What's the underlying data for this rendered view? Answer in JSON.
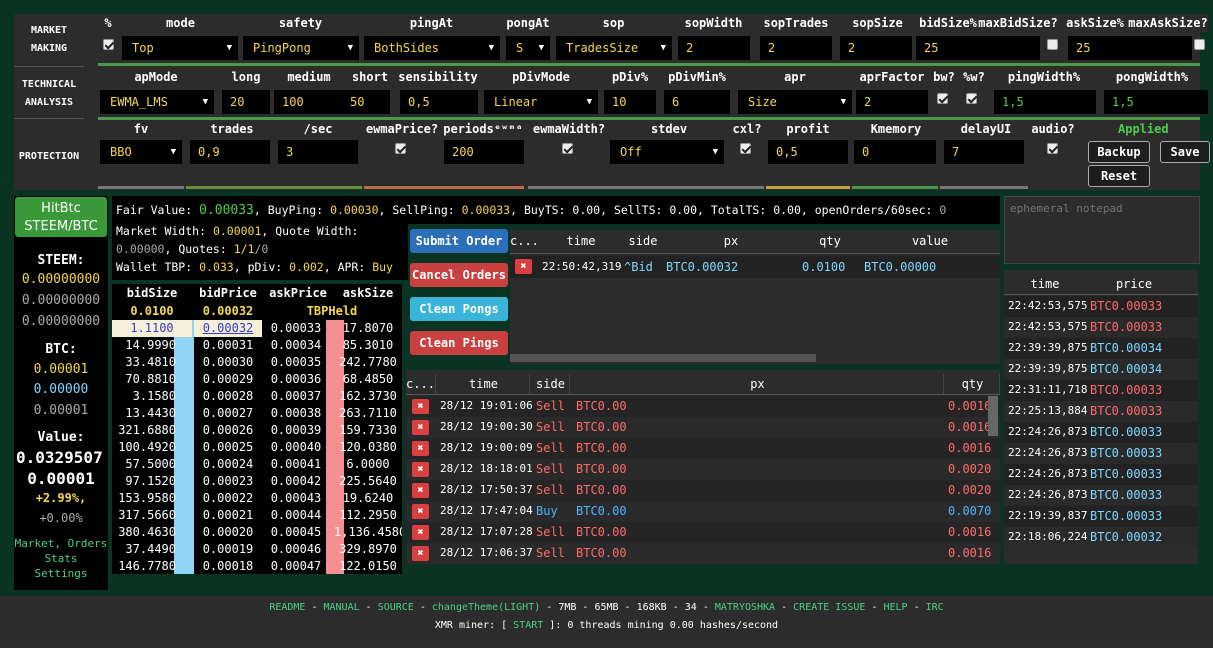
{
  "sections": {
    "market_making": "MARKET\nMAKING",
    "technical_analysis": "TECHNICAL\nANALYSIS",
    "protection": "PROTECTION"
  },
  "mm": {
    "h_pct": "%",
    "h_mode": "mode",
    "h_safety": "safety",
    "h_pingAt": "pingAt",
    "h_pongAt": "pongAt",
    "h_sop": "sop",
    "h_sopWidth": "sopWidth",
    "h_sopTrades": "sopTrades",
    "h_sopSize": "sopSize",
    "h_bidSize": "bidSize%",
    "h_maxBidSize": "maxBidSize?",
    "h_askSize": "askSize%",
    "h_maxAskSize": "maxAskSize?",
    "mode": "Top",
    "safety": "PingPong",
    "pingAt": "BothSides",
    "pongAt": "S",
    "sop": "TradesSize",
    "sopWidth": "2",
    "sopTrades": "2",
    "sopSize": "2",
    "bidSize": "25",
    "askSize": "25"
  },
  "ta": {
    "h_apMode": "apMode",
    "h_long": "long",
    "h_medium": "medium",
    "h_short": "short",
    "h_sensibility": "sensibility",
    "h_pDivMode": "pDivMode",
    "h_pDiv": "pDiv%",
    "h_pDivMin": "pDivMin%",
    "h_apr": "apr",
    "h_aprFactor": "aprFactor",
    "h_bw": "bw?",
    "h_pw": "%w?",
    "h_pingWidth": "pingWidth%",
    "h_pongWidth": "pongWidth%",
    "apMode": "EWMA_LMS",
    "long": "20",
    "medium": "100",
    "short": "50",
    "sensibility": "0,5",
    "pDivMode": "Linear",
    "pDiv": "10",
    "pDivMin": "6",
    "apr": "Size",
    "aprFactor": "2",
    "pingWidth": "1,5",
    "pongWidth": "1,5"
  },
  "prot": {
    "h_fv": "fv",
    "h_trades": "trades",
    "h_sec": "/sec",
    "h_ewmaPrice": "ewmaPrice?",
    "h_periods": "periodsᵉʷᵐᵃ",
    "h_ewmaWidth": "ewmaWidth?",
    "h_stdev": "stdev",
    "h_cxl": "cxl?",
    "h_profit": "profit",
    "h_kmemory": "Kmemory",
    "h_delayUI": "delayUI",
    "h_audio": "audio?",
    "fv": "BBO",
    "trades": "0,9",
    "sec": "3",
    "periods": "200",
    "stdev": "Off",
    "profit": "0,5",
    "kmemory": "0",
    "delayUI": "7",
    "applied": "Applied",
    "backup": "Backup",
    "save": "Save",
    "reset": "Reset"
  },
  "exchange": {
    "name": "HitBtc",
    "pair": "STEEM/BTC"
  },
  "wallet": {
    "base_label": "STEEM:",
    "base_a": "0.00000000",
    "base_b": "0.00000000",
    "base_c": "0.00000000",
    "quote_label": "BTC:",
    "quote_a": "0.00001",
    "quote_b": "0.00000",
    "quote_c": "0.00001",
    "value_label": "Value:",
    "value_a": "0.0329507",
    "value_b": "0.00001",
    "change_a": "+2.99%,",
    "change_b": "+0.00%"
  },
  "links_left": {
    "market": "Market,",
    "orders": "Orders",
    "stats": "Stats",
    "settings": "Settings"
  },
  "status": {
    "fv_label": "Fair Value: ",
    "fv": "0.00033",
    "bp_label": ", BuyPing: ",
    "bp": "0.00030",
    "sp_label": ", SellPing: ",
    "sp": "0.00033",
    "rest1": ", BuyTS: 0.00, SellTS: 0.00, TotalTS: 0.00, openOrders/60sec: ",
    "oo": "0",
    "mw_label": "Market Width: ",
    "mw": "0.00001",
    "qw_label": ", Quote Width:",
    "qw": "0.00000",
    "quotes_label": ", Quotes: ",
    "quotes": "1/1",
    "quotes_tail": "/0",
    "wallet_label": "Wallet TBP: ",
    "tbp": "0.033",
    "pdiv_label": ", pDiv: ",
    "pdiv": "0.002",
    "apr_label": ", APR: ",
    "apr": "Buy"
  },
  "book": {
    "headers": [
      "bidSize",
      "bidPrice",
      "askPrice",
      "askSize"
    ],
    "tbp_row": [
      "0.0100",
      "0.00032",
      "TBPHeld"
    ],
    "rows": [
      [
        "1.1100",
        "0.00032",
        "0.00033",
        "17.8070"
      ],
      [
        "14.9990",
        "0.00031",
        "0.00034",
        "85.3010"
      ],
      [
        "33.4810",
        "0.00030",
        "0.00035",
        "242.7780"
      ],
      [
        "70.8810",
        "0.00029",
        "0.00036",
        "68.4850"
      ],
      [
        "3.1580",
        "0.00028",
        "0.00037",
        "162.3730"
      ],
      [
        "13.4430",
        "0.00027",
        "0.00038",
        "263.7110"
      ],
      [
        "321.6880",
        "0.00026",
        "0.00039",
        "159.7330"
      ],
      [
        "100.4920",
        "0.00025",
        "0.00040",
        "120.0380"
      ],
      [
        "57.5000",
        "0.00024",
        "0.00041",
        "6.0000"
      ],
      [
        "97.1520",
        "0.00023",
        "0.00042",
        "225.5640"
      ],
      [
        "153.9580",
        "0.00022",
        "0.00043",
        "19.6240"
      ],
      [
        "317.5660",
        "0.00021",
        "0.00044",
        "112.2950"
      ],
      [
        "380.4630",
        "0.00020",
        "0.00045",
        "1,136.4580"
      ],
      [
        "37.4490",
        "0.00019",
        "0.00046",
        "329.8970"
      ],
      [
        "146.7780",
        "0.00018",
        "0.00047",
        "122.0150"
      ]
    ]
  },
  "actions": {
    "submit": "Submit Order",
    "cancel": "Cancel Orders",
    "clean_pongs": "Clean Pongs",
    "clean_pings": "Clean Pings"
  },
  "open_orders": {
    "headers": [
      "c...",
      "time",
      "side",
      "px",
      "qty",
      "value"
    ],
    "rows": [
      [
        "22:50:42,319",
        "^Bid",
        "BTC0.00032",
        "0.0100",
        "BTC0.00000"
      ]
    ]
  },
  "notepad": {
    "placeholder": "ephemeral notepad"
  },
  "trades": {
    "headers": [
      "c...",
      "time",
      "side",
      "px",
      "qty"
    ],
    "rows": [
      [
        "28/12 19:01:06",
        "Sell",
        "BTC0.00",
        "0.0016"
      ],
      [
        "28/12 19:00:30",
        "Sell",
        "BTC0.00",
        "0.0016"
      ],
      [
        "28/12 19:00:09",
        "Sell",
        "BTC0.00",
        "0.0016"
      ],
      [
        "28/12 18:18:01",
        "Sell",
        "BTC0.00",
        "0.0020"
      ],
      [
        "28/12 17:50:37",
        "Sell",
        "BTC0.00",
        "0.0020"
      ],
      [
        "28/12 17:47:04",
        "Buy",
        "BTC0.00",
        "0.0070"
      ],
      [
        "28/12 17:07:28",
        "Sell",
        "BTC0.00",
        "0.0016"
      ],
      [
        "28/12 17:06:37",
        "Sell",
        "BTC0.00",
        "0.0016"
      ]
    ]
  },
  "market_trades": {
    "headers": [
      "time",
      "price"
    ],
    "rows": [
      [
        "22:42:53,575",
        "BTC0.00033",
        "sell"
      ],
      [
        "22:42:53,575",
        "BTC0.00033",
        "sell"
      ],
      [
        "22:39:39,875",
        "BTC0.00034",
        "buy"
      ],
      [
        "22:39:39,875",
        "BTC0.00034",
        "buy"
      ],
      [
        "22:31:11,718",
        "BTC0.00033",
        "sell"
      ],
      [
        "22:25:13,884",
        "BTC0.00033",
        "sell"
      ],
      [
        "22:24:26,873",
        "BTC0.00033",
        "buy"
      ],
      [
        "22:24:26,873",
        "BTC0.00033",
        "buy"
      ],
      [
        "22:24:26,873",
        "BTC0.00033",
        "buy"
      ],
      [
        "22:24:26,873",
        "BTC0.00033",
        "buy"
      ],
      [
        "22:19:39,837",
        "BTC0.00033",
        "buy"
      ],
      [
        "22:18:06,224",
        "BTC0.00032",
        "buy"
      ]
    ]
  },
  "footer": {
    "readme": "README",
    "manual": "MANUAL",
    "source": "SOURCE",
    "theme": "changeTheme(LIGHT)",
    "sep": " - ",
    "mem1": "7MB",
    "mem2": "65MB",
    "mem3": "168KB",
    "num": "34",
    "matryoshka": "MATRYOSHKA",
    "issue": "CREATE ISSUE",
    "help": "HELP",
    "irc": "IRC",
    "miner_a": "XMR miner: [ ",
    "start": "START",
    "miner_b": " ]: 0 threads mining 0.00 hashes/second"
  },
  "colors": {
    "accent_green": "#4ad14a",
    "yellow": "#f5d84a",
    "cyan": "#7fd8ff",
    "red": "#d94040",
    "bg": "#0a3324"
  }
}
